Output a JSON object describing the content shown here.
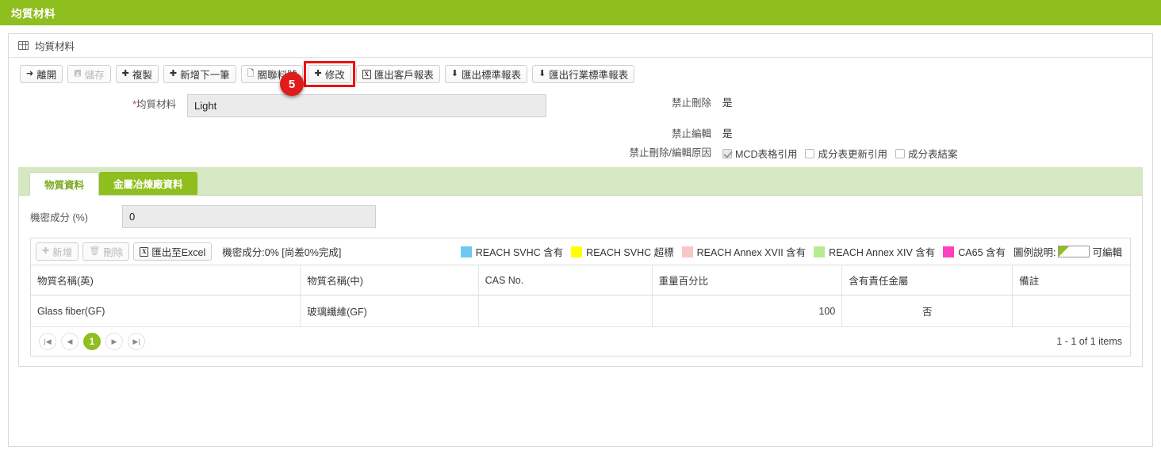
{
  "app": {
    "title": "均質材料"
  },
  "panel": {
    "header_title": "均質材料",
    "header_icon": "grid-table-icon"
  },
  "callout": {
    "number": "5",
    "target": "修改"
  },
  "toolbar": {
    "buttons": [
      {
        "label": "離開",
        "icon": "exit-arrow-icon",
        "glyph": "↷",
        "state": "enabled"
      },
      {
        "label": "儲存",
        "icon": "save-disk-icon",
        "glyph": "▤",
        "state": "disabled"
      },
      {
        "label": "複製",
        "icon": "plus-icon",
        "glyph": "✚",
        "state": "enabled"
      },
      {
        "label": "新增下一筆",
        "icon": "plus-icon",
        "glyph": "✚",
        "state": "enabled"
      },
      {
        "label": "關聯料號",
        "icon": "document-icon",
        "glyph": "▤",
        "state": "enabled"
      },
      {
        "label": "修改",
        "icon": "plus-icon",
        "glyph": "✚",
        "state": "highlighted"
      },
      {
        "label": "匯出客戶報表",
        "icon": "excel-icon",
        "glyph": "X",
        "state": "enabled"
      },
      {
        "label": "匯出標準報表",
        "icon": "download-icon",
        "glyph": "⤓",
        "state": "enabled"
      },
      {
        "label": "匯出行業標準報表",
        "icon": "download-icon",
        "glyph": "⤓",
        "state": "enabled"
      }
    ]
  },
  "form": {
    "material_label": "*均質材料",
    "material_required_mark": "*",
    "material_label_text": "均質材料",
    "material_value": "Light",
    "forbid_delete_label": "禁止刪除",
    "forbid_delete_value": "是",
    "forbid_edit_label": "禁止編輯",
    "forbid_edit_value": "是",
    "reason_label": "禁止刪除/編輯原因",
    "reason_options": [
      {
        "label": "MCD表格引用",
        "checked": true
      },
      {
        "label": "成分表更新引用",
        "checked": false
      },
      {
        "label": "成分表結案",
        "checked": false
      }
    ]
  },
  "tabs": [
    {
      "label": "物質資料",
      "active": true
    },
    {
      "label": "金屬冶煉廠資料",
      "active": false
    }
  ],
  "substance_section": {
    "confidential_label": "機密成分 (%)",
    "confidential_value": "0"
  },
  "grid": {
    "toolbar": {
      "add_label": "新增",
      "add_glyph": "✚",
      "delete_label": "刪除",
      "delete_glyph": "🗑",
      "export_label": "匯出至Excel",
      "export_icon": "excel-icon",
      "status_text": "機密成分:0% [尚差0%完成]"
    },
    "legend": {
      "items": [
        {
          "label": "REACH SVHC 含有",
          "color": "#6dc8f3"
        },
        {
          "label": "REACH SVHC 超標",
          "color": "#ffff00"
        },
        {
          "label": "REACH Annex XVII 含有",
          "color": "#f9c6c6"
        },
        {
          "label": "REACH Annex XIV 含有",
          "color": "#b7eb8f"
        },
        {
          "label": "CA65 含有",
          "color": "#ff3fbb"
        }
      ],
      "note_label": "圖例說明:",
      "note_swatch_color": "#8fbe1f",
      "note_text": "可編輯"
    },
    "columns": [
      "物質名稱(英)",
      "物質名稱(中)",
      "CAS No.",
      "重量百分比",
      "含有責任金屬",
      "備註"
    ],
    "rows": [
      {
        "name_en": "Glass fiber(GF)",
        "name_zh": "玻璃纖維(GF)",
        "cas_no": "",
        "weight_pct": "100",
        "has_metal": "否",
        "remark": ""
      }
    ],
    "pager": {
      "first_glyph": "|◀",
      "prev_glyph": "◀",
      "current_page": "1",
      "next_glyph": "▶",
      "last_glyph": "▶|",
      "info": "1 - 1 of 1 items"
    }
  }
}
